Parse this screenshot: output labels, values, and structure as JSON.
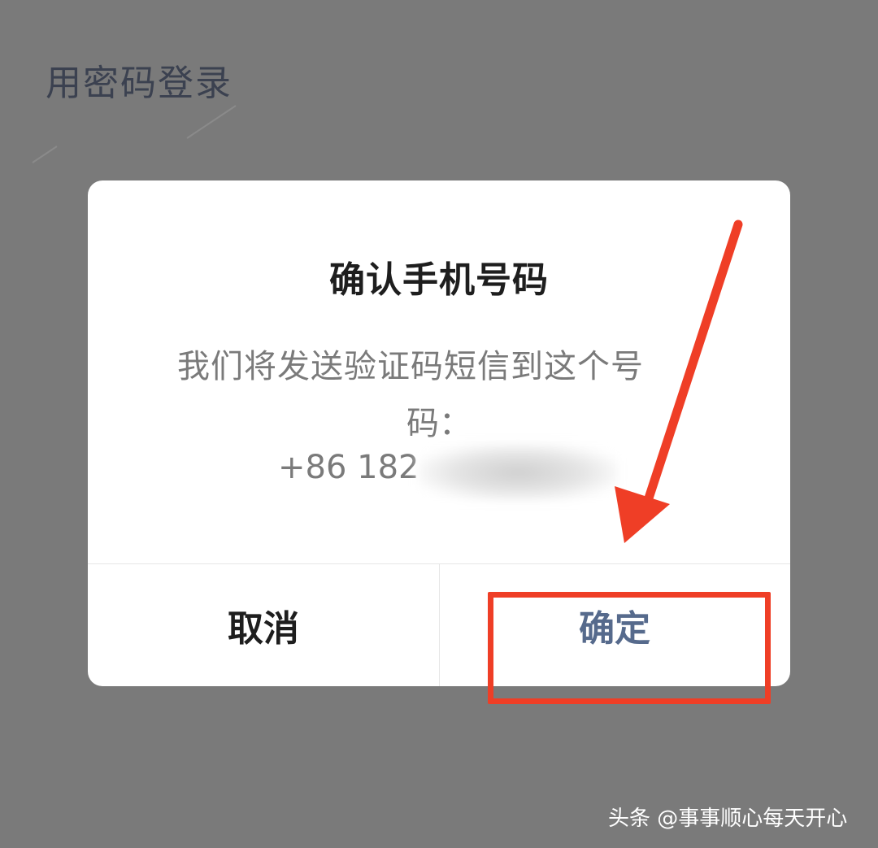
{
  "background": {
    "title": "用密码登录"
  },
  "dialog": {
    "title": "确认手机号码",
    "message_line1": "我们将发送验证码短信到这个号",
    "message_line2": "码：",
    "phone_visible": "+86 182",
    "cancel_label": "取消",
    "confirm_label": "确定"
  },
  "annotation": {
    "color": "#ef3e26"
  },
  "watermark": {
    "text": "头条 @事事顺心每天开心"
  },
  "colors": {
    "overlay": "#7a7a7a",
    "dialog_bg": "#ffffff",
    "confirm_text": "#566a8c",
    "cancel_text": "#1e1e1e"
  }
}
